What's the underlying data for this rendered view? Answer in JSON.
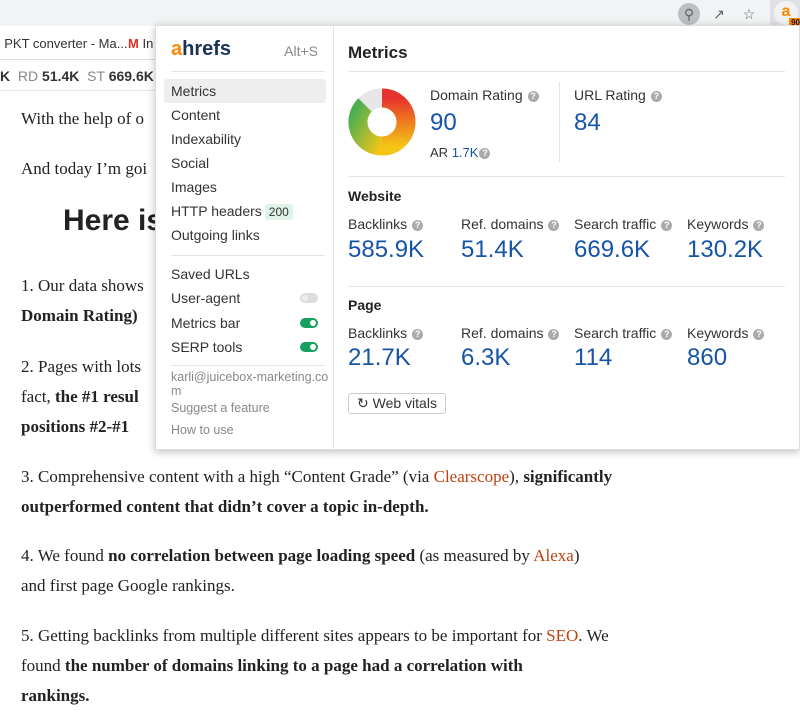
{
  "browser": {
    "toolbar_icons": [
      "search-extension-icon",
      "share-icon",
      "star-icon"
    ],
    "ahrefs_badge": "90",
    "bookmarks": [
      "PKT converter - Ma...",
      "In"
    ],
    "metrics_bar": {
      "prefix": "K",
      "rd_label": "RD",
      "rd_value": "51.4K",
      "st_label": "ST",
      "st_value": "669.6K"
    }
  },
  "article": {
    "p1": "With the help of o",
    "p2": "And today I’m goi",
    "heading": "Here is",
    "p3a": "1. Our data shows",
    "p3b": "Domain Rating)",
    "p4a": "2. Pages with lots",
    "p4b_text": "fact, ",
    "p4b_bold": "the #1 resul",
    "p4c": "positions #2-#1",
    "p5a_text": "3. Comprehensive content with a high “Content Grade” (via ",
    "p5a_link": "Clearscope",
    "p5a_end": "), ",
    "p5a_bold": "significantly",
    "p5b": "outperformed content that didn’t cover a topic in-depth.",
    "p6a_text": "4. We found ",
    "p6a_bold": "no correlation between page loading speed",
    "p6a_mid": " (as measured by ",
    "p6a_link": "Alexa",
    "p6a_end": ")",
    "p6b": "and first page Google rankings.",
    "p7a_text": "5. Getting backlinks from multiple different sites appears to be important for ",
    "p7a_link": "SEO",
    "p7a_end": ". We",
    "p7b_text": "found ",
    "p7b_bold": "the number of domains linking to a page had a correlation with",
    "p7c": "rankings."
  },
  "popup": {
    "logo": "ahrefs",
    "shortcut": "Alt+S",
    "menu": [
      {
        "label": "Metrics",
        "active": true
      },
      {
        "label": "Content"
      },
      {
        "label": "Indexability"
      },
      {
        "label": "Social"
      },
      {
        "label": "Images"
      },
      {
        "label": "HTTP headers",
        "badge": "200"
      },
      {
        "label": "Outgoing links"
      }
    ],
    "menu2": [
      {
        "label": "Saved URLs"
      },
      {
        "label": "User-agent",
        "toggle": false
      },
      {
        "label": "Metrics bar",
        "toggle": true
      },
      {
        "label": "SERP tools",
        "toggle": true
      }
    ],
    "account": "karli@juicebox-marketing.com",
    "suggest": "Suggest a feature",
    "howto": "How to use",
    "title": "Metrics",
    "dr_label": "Domain Rating",
    "dr_value": "90",
    "ar_label": "AR",
    "ar_value": "1.7K",
    "ur_label": "URL Rating",
    "ur_value": "84",
    "website_label": "Website",
    "website": [
      {
        "label": "Backlinks",
        "value": "585.9K"
      },
      {
        "label": "Ref. domains",
        "value": "51.4K"
      },
      {
        "label": "Search traffic",
        "value": "669.6K"
      },
      {
        "label": "Keywords",
        "value": "130.2K"
      }
    ],
    "page_label": "Page",
    "page": [
      {
        "label": "Backlinks",
        "value": "21.7K"
      },
      {
        "label": "Ref. domains",
        "value": "6.3K"
      },
      {
        "label": "Search traffic",
        "value": "114"
      },
      {
        "label": "Keywords",
        "value": "860"
      }
    ],
    "web_vitals": "Web vitals",
    "colors": {
      "accent": "#ff8800",
      "value": "#1554a6",
      "toggle_on": "#17a062"
    }
  }
}
